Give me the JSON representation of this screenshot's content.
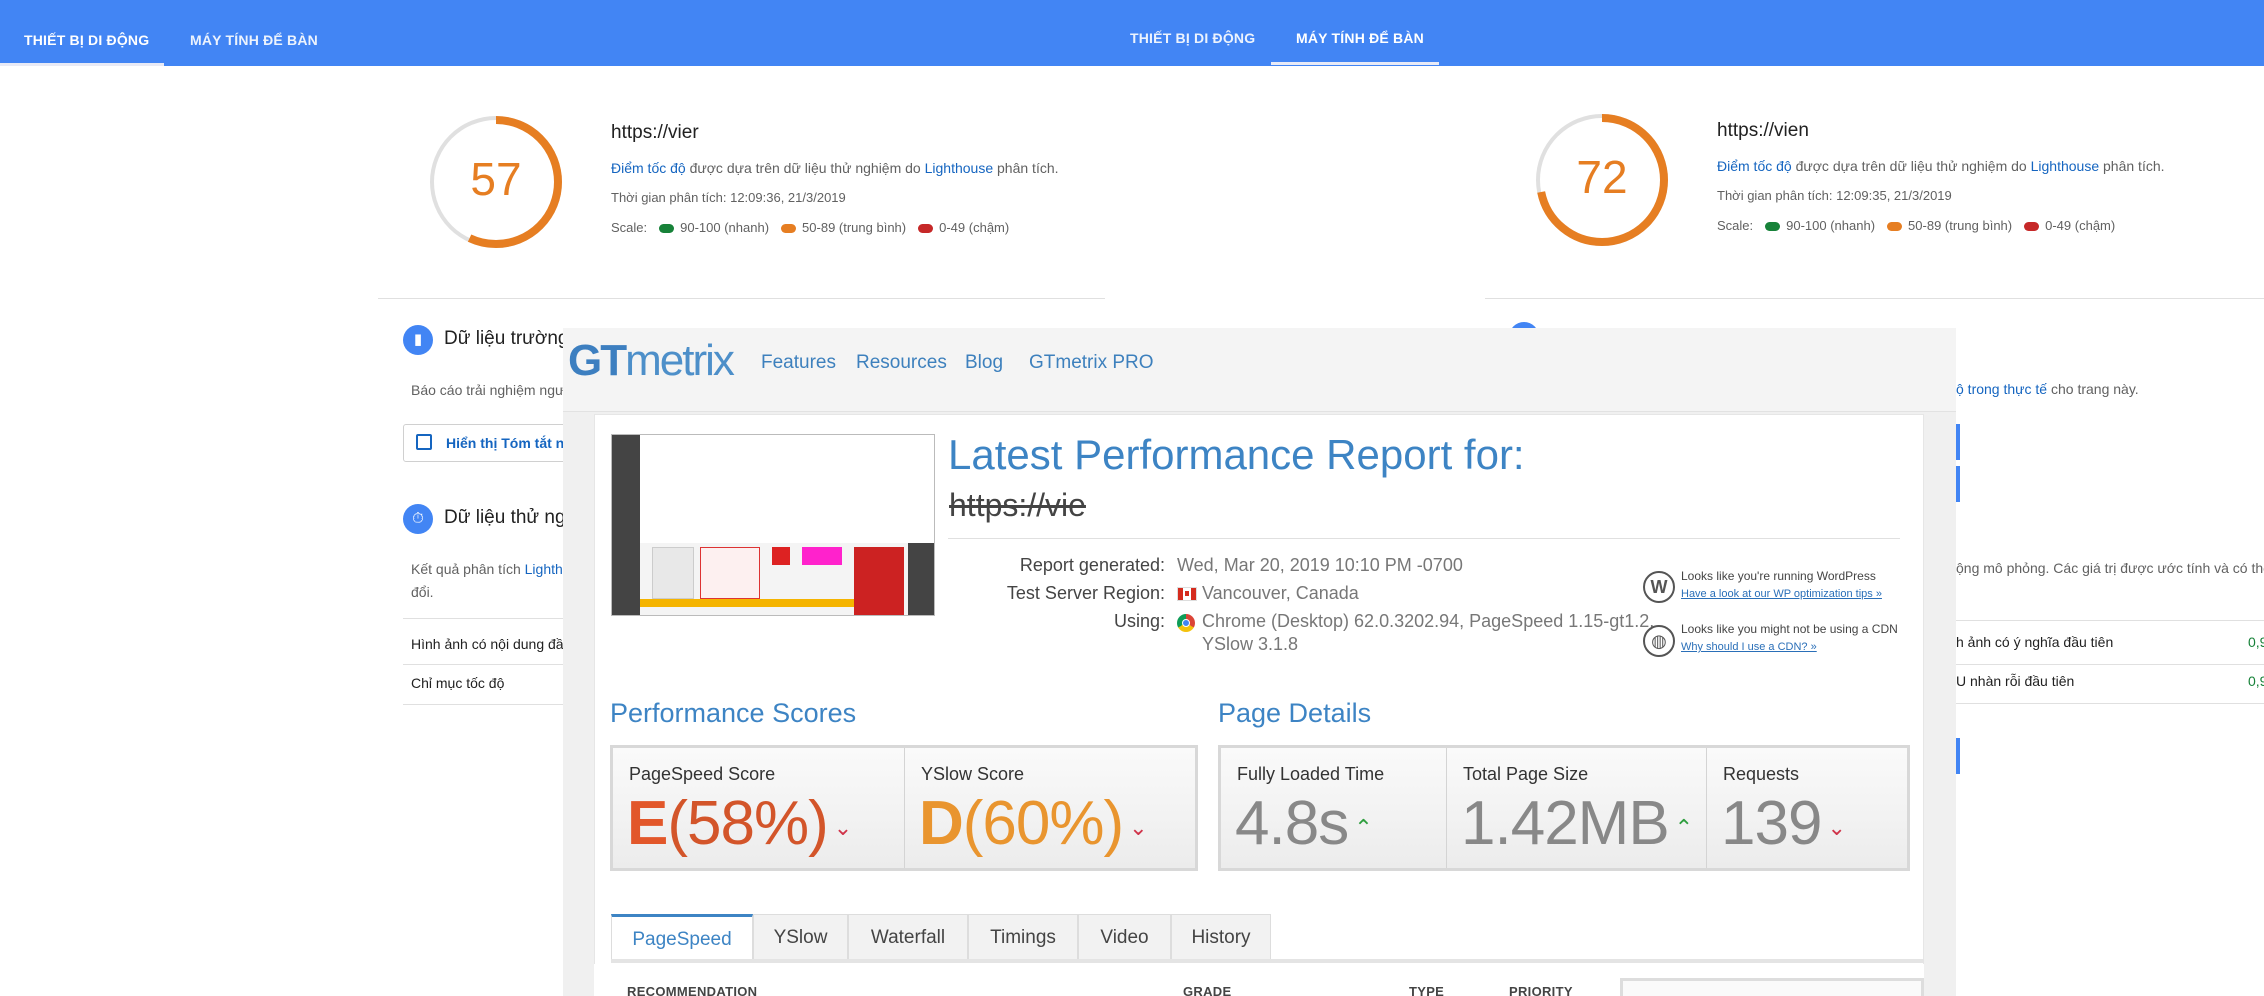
{
  "left_panel": {
    "tabs": [
      {
        "label": "THIẾT BỊ DI ĐỘNG"
      },
      {
        "label": "MÁY TÍNH ĐỂ BÀN"
      }
    ],
    "score": "57",
    "url": "https://vier",
    "speed_label": "Điểm tốc độ",
    "speed_text": " được dựa trên dữ liệu thử nghiệm do ",
    "lighthouse": "Lighthouse",
    "speed_tail": " phân tích.",
    "time": "Thời gian phân tích: 12:09:36, 21/3/2019",
    "scale_label": "Scale:",
    "scale": [
      "90-100 (nhanh)",
      "50-89 (trung bình)",
      "0-49 (chậm)"
    ],
    "field_title": "Dữ liệu trường",
    "field_text": "Báo cáo trải nghiệm ngư",
    "summary_button": "Hiển thị Tóm tắt ng",
    "lab_title": "Dữ liệu thử nghi",
    "lab_text_1": "Kết quả phân tích ",
    "lab_text_link": "Lighth",
    "lab_text_2": "đổi.",
    "metrics": [
      "Hình ảnh có nội dung đầ",
      "Chỉ mục tốc độ"
    ]
  },
  "right_panel": {
    "tabs": [
      {
        "label": "THIẾT BỊ DI ĐỘNG"
      },
      {
        "label": "MÁY TÍNH ĐỂ BÀN"
      }
    ],
    "score": "72",
    "url": "https://vien",
    "speed_label": "Điểm tốc độ",
    "speed_text": " được dựa trên dữ liệu thử nghiệm do ",
    "lighthouse": "Lighthouse",
    "speed_tail": " phân tích.",
    "time": "Thời gian phân tích: 12:09:35, 21/3/2019",
    "scale_label": "Scale:",
    "scale": [
      "90-100 (nhanh)",
      "50-89 (trung bình)",
      "0-49 (chậm)"
    ],
    "field_link": "ộ trong thực tế",
    "field_tail": " cho trang này.",
    "lab_note": "ộng mô phỏng. Các giá trị được ước tính và có thể",
    "metrics": [
      {
        "label": "h ảnh có ý nghĩa đầu tiên",
        "value": "0,9"
      },
      {
        "label": "U nhàn rỗi đầu tiên",
        "value": "0,9"
      }
    ]
  },
  "gtmetrix": {
    "logo_a": "GT",
    "logo_b": "metrix",
    "nav": [
      "Features",
      "Resources",
      "Blog",
      "GTmetrix PRO"
    ],
    "heading": "Latest Performance Report for:",
    "url": "https://vie",
    "report_generated_label": "Report generated:",
    "report_generated": "Wed, Mar 20, 2019 10:10 PM -0700",
    "region_label": "Test Server Region:",
    "region": "Vancouver, Canada",
    "using_label": "Using:",
    "using_1": "Chrome (Desktop) 62.0.3202.94, PageSpeed 1.15-gt1.2,",
    "using_2": "YSlow 3.1.8",
    "wp_note": "Looks like you're running WordPress",
    "wp_link": "Have a look at our WP optimization tips »",
    "cdn_note": "Looks like you might not be using a CDN",
    "cdn_link": "Why should I use a CDN? »",
    "perf_title": "Performance Scores",
    "details_title": "Page Details",
    "pagespeed_label": "PageSpeed Score",
    "pagespeed_grade": "E",
    "pagespeed_pct": "(58%)",
    "yslow_label": "YSlow Score",
    "yslow_grade": "D",
    "yslow_pct": "(60%)",
    "loaded_label": "Fully Loaded Time",
    "loaded": "4.8s",
    "size_label": "Total Page Size",
    "size": "1.42MB",
    "requests_label": "Requests",
    "requests": "139",
    "tabs": [
      "PageSpeed",
      "YSlow",
      "Waterfall",
      "Timings",
      "Video",
      "History"
    ],
    "table_headers": [
      "RECOMMENDATION",
      "GRADE",
      "TYPE",
      "PRIORITY"
    ],
    "colors": {
      "blue": "#3d84c4",
      "grade_e": "#d9622b",
      "grade_d": "#e9952f",
      "up": "#2e9e3e",
      "down": "#d0344a"
    }
  }
}
